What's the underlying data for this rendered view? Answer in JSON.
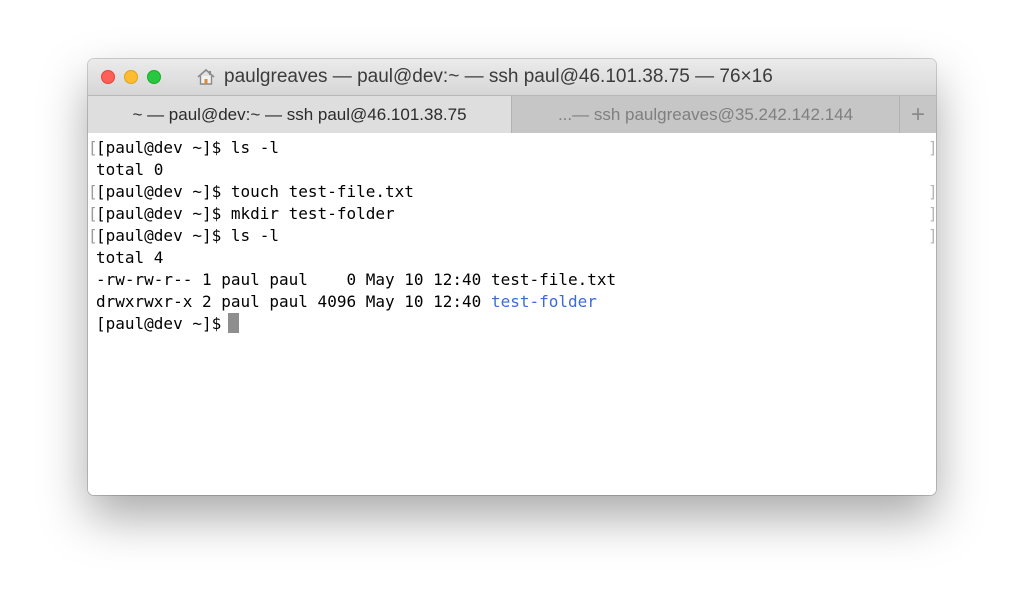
{
  "window": {
    "title": "paulgreaves — paul@dev:~ — ssh paul@46.101.38.75 — 76×16",
    "title_icon": "home-icon"
  },
  "tabs": [
    {
      "label": "~ — paul@dev:~ — ssh paul@46.101.38.75",
      "active": true
    },
    {
      "label": "...— ssh paulgreaves@35.242.142.144",
      "active": false
    }
  ],
  "new_tab_label": "+",
  "terminal": {
    "lines": [
      {
        "text": "[paul@dev ~]$ ls -l",
        "marked": true
      },
      {
        "text": "total 0",
        "marked": false
      },
      {
        "text": "[paul@dev ~]$ touch test-file.txt",
        "marked": true
      },
      {
        "text": "[paul@dev ~]$ mkdir test-folder",
        "marked": true
      },
      {
        "text": "[paul@dev ~]$ ls -l",
        "marked": true
      },
      {
        "text": "total 4",
        "marked": false
      },
      {
        "text": "-rw-rw-r-- 1 paul paul    0 May 10 12:40 test-file.txt",
        "marked": false
      },
      {
        "text": "drwxrwxr-x 2 paul paul 4096 May 10 12:40 ",
        "marked": false,
        "dir": "test-folder"
      }
    ],
    "prompt": "[paul@dev ~]$",
    "mark_left": "[",
    "mark_right": "]",
    "dir_color": "#3d6bd6"
  },
  "colors": {
    "close": "#fe5f57",
    "minimize": "#febc2e",
    "zoom": "#28c840"
  }
}
